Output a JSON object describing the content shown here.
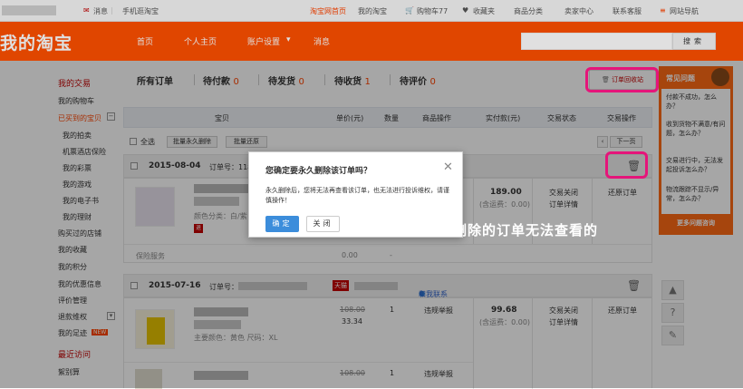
{
  "topbar": {
    "messages": "消息",
    "mobile": "手机逛淘宝",
    "home": "淘宝网首页",
    "my_taobao": "我的淘宝",
    "cart": "购物车",
    "cart_count": "77",
    "favorites": "收藏夹",
    "categories": "商品分类",
    "seller_center": "卖家中心",
    "service": "联系客服",
    "site_nav": "网站导航"
  },
  "header": {
    "logo": "我的淘宝",
    "nav": [
      "首页",
      "个人主页",
      "账户设置",
      "消息"
    ],
    "search_button": "搜索"
  },
  "sidebar": {
    "my_trades": "我的交易",
    "items": [
      {
        "label": "我的购物车",
        "type": "item"
      },
      {
        "label": "已买到的宝贝",
        "type": "active"
      },
      {
        "label": "我的拍卖",
        "type": "sub"
      },
      {
        "label": "机票酒店保险",
        "type": "sub"
      },
      {
        "label": "我的彩票",
        "type": "sub"
      },
      {
        "label": "我的游戏",
        "type": "sub"
      },
      {
        "label": "我的电子书",
        "type": "sub"
      },
      {
        "label": "我的理财",
        "type": "sub"
      },
      {
        "label": "购买过的店铺",
        "type": "item"
      },
      {
        "label": "我的收藏",
        "type": "item"
      },
      {
        "label": "我的积分",
        "type": "item"
      },
      {
        "label": "我的优惠信息",
        "type": "item"
      },
      {
        "label": "评价管理",
        "type": "item"
      },
      {
        "label": "退款维权",
        "type": "item"
      },
      {
        "label": "我的足迹",
        "type": "item"
      }
    ],
    "new_badge": "NEW",
    "recent_visits": "最近访问",
    "last_item": "絮别算"
  },
  "tabs": [
    {
      "label": "所有订单",
      "count": ""
    },
    {
      "label": "待付款",
      "count": "0"
    },
    {
      "label": "待发货",
      "count": "0"
    },
    {
      "label": "待收货",
      "count": "1"
    },
    {
      "label": "待评价",
      "count": "0"
    }
  ],
  "recycle_button": "订单回收站",
  "table_header": [
    "宝贝",
    "单价(元)",
    "数量",
    "商品操作",
    "实付款(元)",
    "交易状态",
    "交易操作"
  ],
  "bulk": {
    "select_all": "全选",
    "delete_permanent": "批量永久删除",
    "restore": "批量还原",
    "next_page": "下一页"
  },
  "orders": [
    {
      "date": "2015-08-04",
      "order_no_label": "订单号：118",
      "sku": "颜色分类：白/紫",
      "total": "189.00",
      "shipping": "(含运费：0.00)",
      "status": "交易关闭",
      "detail": "订单详情",
      "action": "还原订单",
      "service_label": "保险服务",
      "service_price": "0.00",
      "service_dash": "-"
    },
    {
      "date": "2015-07-16",
      "order_no_label": "订单号：",
      "tmall": "天猫",
      "contact": "和我联系",
      "sku": "主要颜色：黄色  尺码：XL",
      "orig_price": "108.00",
      "price": "33.34",
      "qty": "1",
      "op": "违规举报",
      "total": "99.68",
      "shipping": "(含运费：0.00)",
      "status": "交易关闭",
      "detail": "订单详情",
      "action": "还原订单",
      "row2_orig": "108.00",
      "row2_qty": "1",
      "row2_op": "违规举报"
    }
  ],
  "faq": {
    "title": "常见问题",
    "questions": [
      "付款不成功，怎么办？",
      "收到货物不满意/有问题，怎么办？",
      "交易进行中，无法发起投诉怎么办？",
      "物流跟踪不显示/异常，怎么办？"
    ],
    "more": "更多问题咨询"
  },
  "dialog": {
    "title": "您确定要永久删除该订单吗？",
    "message": "永久删除后，您将无法再查看该订单，也无法进行投诉维权，请谨慎操作！",
    "ok": "确定",
    "cancel": "关闭"
  },
  "annotation": "在订单回收站删除的订单无法查看的",
  "colors": {
    "brand": "#ff5000",
    "highlight": "#e5157a",
    "primary_button": "#3c8ddb"
  }
}
